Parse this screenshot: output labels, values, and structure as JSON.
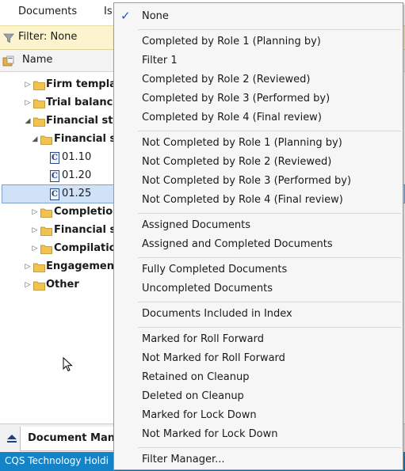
{
  "menubar": {
    "tab_documents": "Documents",
    "tab_issues": "Is"
  },
  "filter": {
    "label": "Filter: None",
    "icon": "filter-icon"
  },
  "columns": {
    "name": "Name"
  },
  "tree": {
    "nodes": [
      {
        "label": "Firm templa",
        "bold": true
      },
      {
        "label": "Trial balance",
        "bold": true
      },
      {
        "label": "Financial sta",
        "bold": true
      },
      {
        "label": "Financial st",
        "bold": true
      },
      {
        "label": "01.10",
        "bold": false,
        "icon_letter": "C"
      },
      {
        "label": "01.20",
        "bold": false,
        "icon_letter": "C"
      },
      {
        "label": "01.25",
        "bold": false,
        "icon_letter": "C"
      },
      {
        "label": "Completion",
        "bold": true
      },
      {
        "label": "Financial st",
        "bold": true
      },
      {
        "label": "Compilatio",
        "bold": true
      },
      {
        "label": "Engagement",
        "bold": true
      },
      {
        "label": "Other",
        "bold": true
      }
    ]
  },
  "bottom_tab": {
    "label": "Document Man"
  },
  "status": {
    "text": "CQS Technology Holdi"
  },
  "menu": {
    "checkmark": "✓",
    "items": [
      {
        "label": "None",
        "checked": true
      },
      {
        "label": "Completed by Role 1 (Planning by)"
      },
      {
        "label": "Filter 1"
      },
      {
        "label": "Completed by Role 2 (Reviewed)"
      },
      {
        "label": "Completed by Role 3 (Performed by)"
      },
      {
        "label": "Completed by Role 4 (Final review)"
      },
      {
        "label": "Not Completed by Role 1 (Planning by)"
      },
      {
        "label": "Not Completed by Role 2 (Reviewed)"
      },
      {
        "label": "Not Completed by Role 3 (Performed by)"
      },
      {
        "label": "Not Completed by Role 4 (Final review)"
      },
      {
        "label": "Assigned Documents"
      },
      {
        "label": "Assigned and Completed Documents"
      },
      {
        "label": "Fully Completed Documents"
      },
      {
        "label": "Uncompleted Documents"
      },
      {
        "label": "Documents Included in Index"
      },
      {
        "label": "Marked for Roll Forward"
      },
      {
        "label": "Not Marked for Roll Forward"
      },
      {
        "label": "Retained on Cleanup"
      },
      {
        "label": "Deleted on Cleanup"
      },
      {
        "label": "Marked for Lock Down"
      },
      {
        "label": "Not Marked for Lock Down"
      },
      {
        "label": "Filter Manager..."
      }
    ]
  },
  "colors": {
    "accent": "#1e56c8",
    "status_bar": "#1583c7",
    "filter_bar": "#fbf4cf",
    "selection": "#cfe2f8"
  }
}
